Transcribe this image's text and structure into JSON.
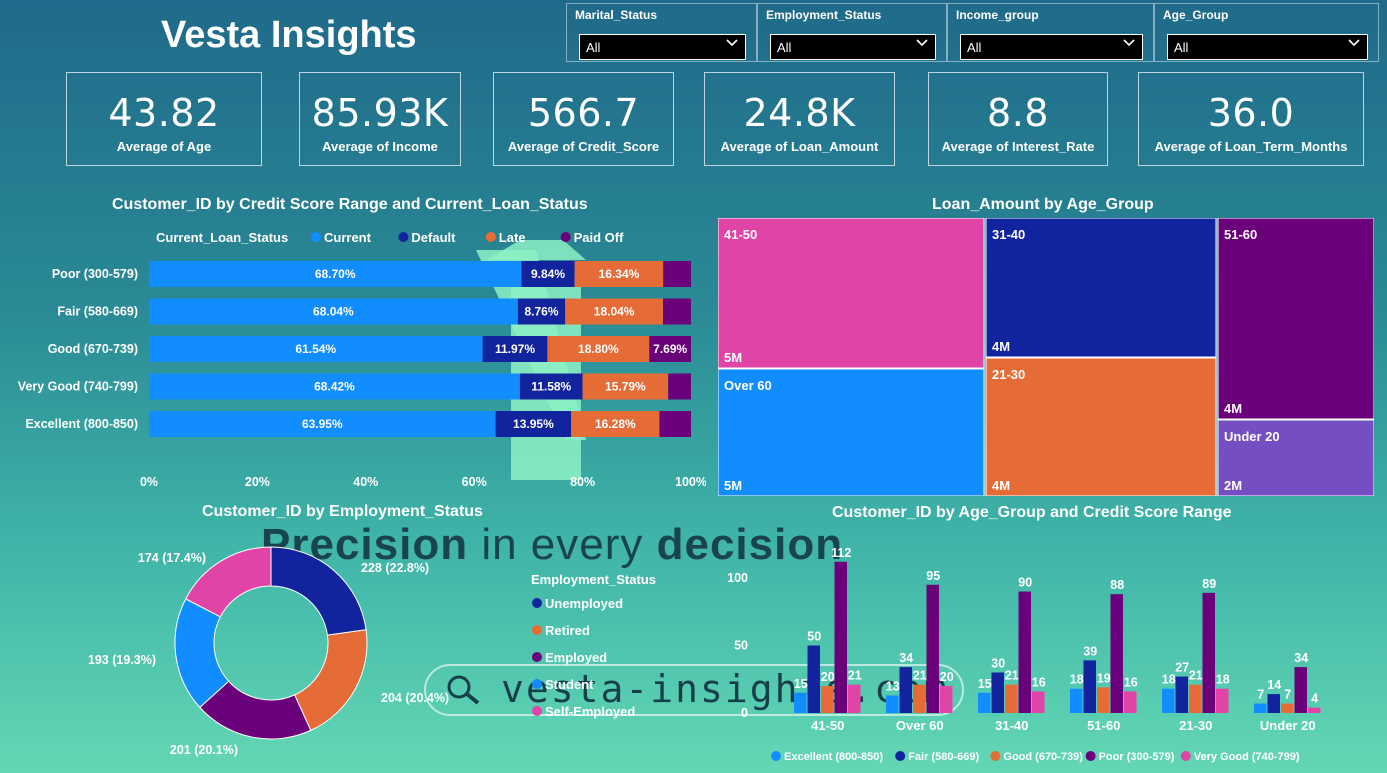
{
  "app_title": "Vesta Insights",
  "slicers": [
    {
      "label": "Marital_Status",
      "value": "All"
    },
    {
      "label": "Employment_Status",
      "value": "All"
    },
    {
      "label": "Income_group",
      "value": "All"
    },
    {
      "label": "Age_Group",
      "value": "All"
    }
  ],
  "kpis": [
    {
      "value": "43.82",
      "label": "Average of Age"
    },
    {
      "value": "85.93K",
      "label": "Average of Income"
    },
    {
      "value": "566.7",
      "label": "Average of Credit_Score"
    },
    {
      "value": "24.8K",
      "label": "Average of Loan_Amount"
    },
    {
      "value": "8.8",
      "label": "Average of Interest_Rate"
    },
    {
      "value": "36.0",
      "label": "Average of Loan_Term_Months"
    }
  ],
  "watermark": {
    "part1": "Precision",
    "part2": " in every ",
    "part3": "decision",
    "url": "vesta-insights.com"
  },
  "colors": {
    "current": "#118dff",
    "default": "#12239e",
    "late": "#e66c37",
    "paid_off": "#6b007b",
    "very_good": "#e044a7",
    "under20": "#744ec2"
  },
  "chart_data": [
    {
      "type": "bar",
      "orientation": "horizontal-stacked-100",
      "title": "Customer_ID by Credit Score Range and Current_Loan_Status",
      "legend_title": "Current_Loan_Status",
      "legend_position": "top",
      "categories": [
        "Poor (300-579)",
        "Fair (580-669)",
        "Good (670-739)",
        "Very Good (740-799)",
        "Excellent (800-850)"
      ],
      "series": [
        {
          "name": "Current",
          "values": [
            68.7,
            68.04,
            61.54,
            68.42,
            63.95
          ],
          "labels": [
            "68.70%",
            "68.04%",
            "61.54%",
            "68.42%",
            "63.95%"
          ]
        },
        {
          "name": "Default",
          "values": [
            9.84,
            8.76,
            11.97,
            11.58,
            13.95
          ],
          "labels": [
            "9.84%",
            "8.76%",
            "11.97%",
            "11.58%",
            "13.95%"
          ]
        },
        {
          "name": "Late",
          "values": [
            16.34,
            18.04,
            18.8,
            15.79,
            16.28
          ],
          "labels": [
            "16.34%",
            "18.04%",
            "18.80%",
            "15.79%",
            "16.28%"
          ]
        },
        {
          "name": "Paid Off",
          "values": [
            5.12,
            5.16,
            7.69,
            4.21,
            5.82
          ],
          "labels": [
            "",
            "",
            "7.69%",
            "",
            ""
          ]
        }
      ],
      "x_ticks": [
        "0%",
        "20%",
        "40%",
        "60%",
        "80%",
        "100%"
      ],
      "xlim": [
        0,
        100
      ]
    },
    {
      "type": "treemap",
      "title": "Loan_Amount by Age_Group",
      "items": [
        {
          "name": "41-50",
          "label": "5M",
          "value": 5
        },
        {
          "name": "Over 60",
          "label": "5M",
          "value": 5
        },
        {
          "name": "31-40",
          "label": "4M",
          "value": 4
        },
        {
          "name": "21-30",
          "label": "4M",
          "value": 4
        },
        {
          "name": "51-60",
          "label": "4M",
          "value": 4
        },
        {
          "name": "Under 20",
          "label": "2M",
          "value": 2
        }
      ]
    },
    {
      "type": "pie",
      "variant": "donut",
      "title": "Customer_ID by Employment_Status",
      "legend_title": "Employment_Status",
      "slices": [
        {
          "name": "Unemployed",
          "value": 228,
          "label": "228 (22.8%)"
        },
        {
          "name": "Retired",
          "value": 204,
          "label": "204 (20.4%)"
        },
        {
          "name": "Employed",
          "value": 201,
          "label": "201 (20.1%)"
        },
        {
          "name": "Student",
          "value": 193,
          "label": "193 (19.3%)"
        },
        {
          "name": "Self-Employed",
          "value": 174,
          "label": "174 (17.4%)"
        }
      ]
    },
    {
      "type": "bar",
      "orientation": "vertical-clustered",
      "title": "Customer_ID by Age_Group and Credit Score Range",
      "legend_position": "bottom",
      "categories": [
        "41-50",
        "Over 60",
        "31-40",
        "51-60",
        "21-30",
        "Under 20"
      ],
      "series": [
        {
          "name": "Excellent (800-850)",
          "values": [
            15,
            13,
            15,
            18,
            18,
            7
          ]
        },
        {
          "name": "Fair (580-669)",
          "values": [
            50,
            34,
            30,
            39,
            27,
            14
          ]
        },
        {
          "name": "Good (670-739)",
          "values": [
            20,
            21,
            21,
            19,
            21,
            7
          ]
        },
        {
          "name": "Poor (300-579)",
          "values": [
            112,
            95,
            90,
            88,
            89,
            34
          ]
        },
        {
          "name": "Very Good (740-799)",
          "values": [
            21,
            20,
            16,
            16,
            18,
            4
          ]
        }
      ],
      "y_ticks": [
        "0",
        "50",
        "100"
      ],
      "ylim": [
        0,
        120
      ]
    }
  ]
}
